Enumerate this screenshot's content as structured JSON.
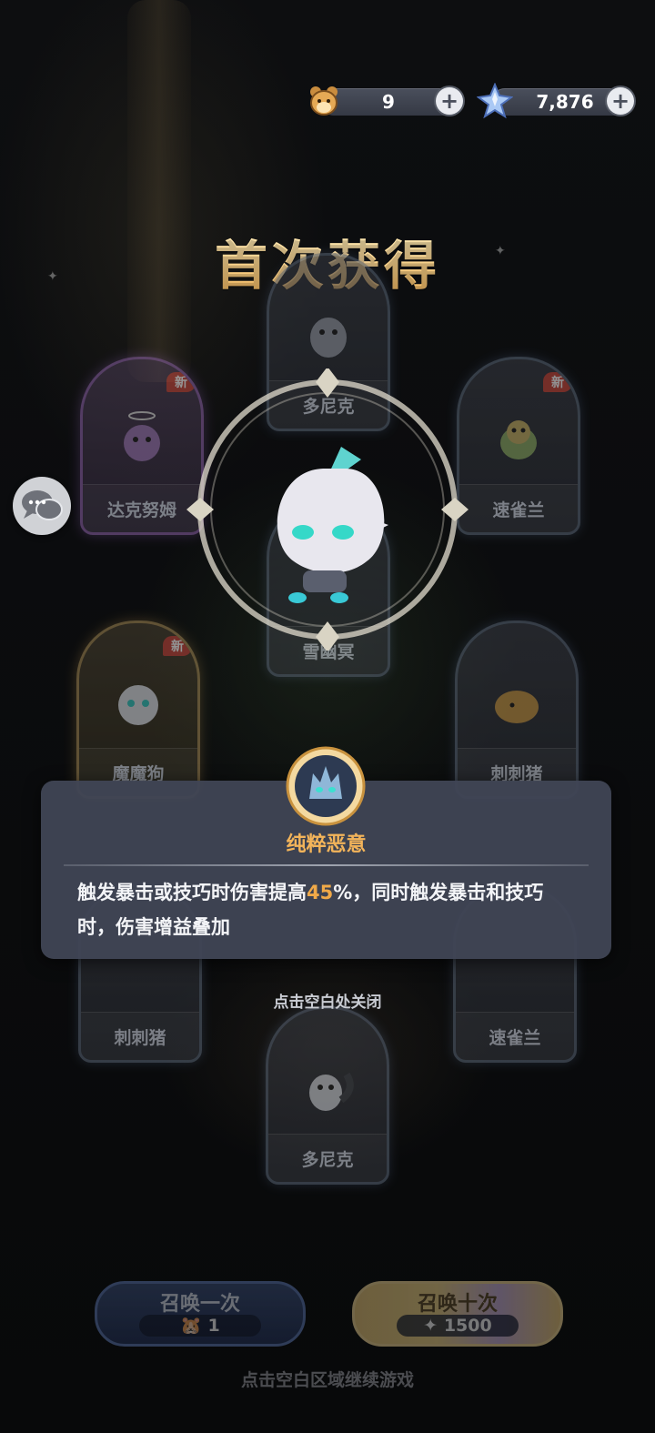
{
  "currency": {
    "pets": {
      "value": "9",
      "icon": "hamster-icon"
    },
    "gems": {
      "value": "7,876",
      "icon": "crystal-icon"
    },
    "plus": "+"
  },
  "title": "首次获得",
  "badge_new": "新",
  "cards": {
    "top": "多尼克",
    "left_upper": "达克努姆",
    "right_upper": "速雀兰",
    "center": "雪幽冥",
    "left_mid": "魔魔狗",
    "right_mid": "刺刺猪",
    "left_low": "刺刺猪",
    "right_low": "速雀兰",
    "bottom": "多尼克"
  },
  "skill": {
    "name": "纯粹恶意",
    "desc_before": "触发暴击或技巧时伤害提高",
    "desc_value": "45",
    "desc_after": "%，同时触发暴击和技巧时，伤害增益叠加"
  },
  "close_hint": "点击空白处关闭",
  "summon_once": {
    "label": "召唤一次",
    "cost": "1"
  },
  "summon_ten": {
    "label": "召唤十次",
    "cost": "1500"
  },
  "continue_hint": "点击空白区域继续游戏",
  "colors": {
    "title_gold": "#f4c26b",
    "highlight": "#f0a948",
    "panel": "#3f4554"
  }
}
